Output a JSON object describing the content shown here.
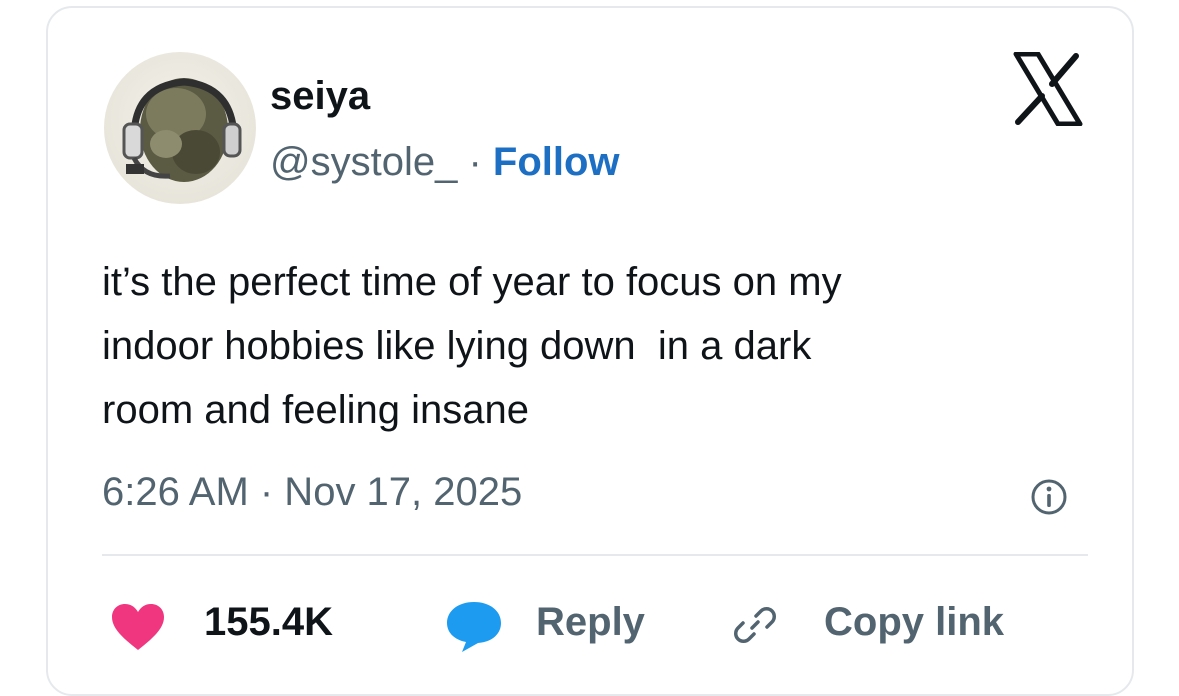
{
  "tweet": {
    "display_name": "seiya",
    "handle": "@systole_",
    "separator": " · ",
    "follow_label": "Follow",
    "text": "it’s the perfect time of year to focus on my\nindoor hobbies like lying down  in a dark\nroom and feeling insane",
    "timestamp": "6:26 AM · Nov 17, 2025"
  },
  "actions": {
    "likes_count": "155.4K",
    "reply_label": "Reply",
    "copy_label": "Copy link"
  },
  "icons": {
    "brand": "x-logo-icon",
    "info": "info-icon",
    "like": "heart-icon",
    "reply": "speech-bubble-icon",
    "copy": "link-icon"
  },
  "colors": {
    "follow": "#1d6fc4",
    "heart": "#f0367f",
    "reply_bubble": "#1d9bf0",
    "muted_text": "#536471",
    "primary_text": "#0f1419"
  }
}
